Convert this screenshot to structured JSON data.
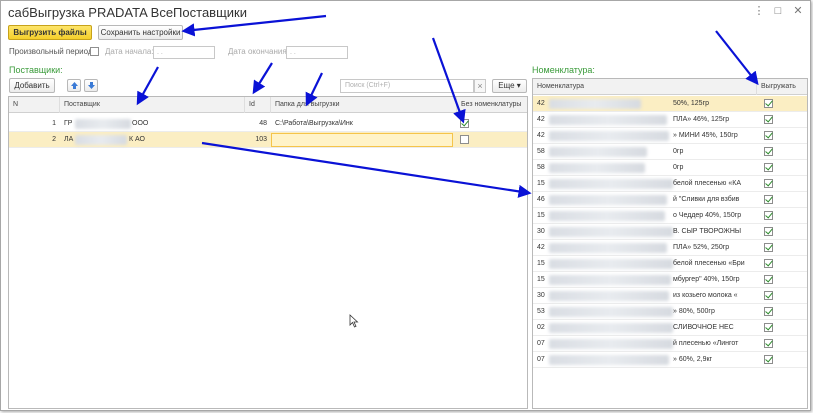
{
  "window": {
    "title": "сабВыгрузка PRADATA ВсеПоставщики",
    "controls": [
      "⋮",
      "□",
      "✕"
    ]
  },
  "toolbar": {
    "export_label": "Выгрузить файлы",
    "save_label": "Сохранить настройки"
  },
  "period": {
    "custom_label": "Произвольный период:",
    "start_label": "Дата начала:",
    "start_placeholder": "  .  .",
    "end_label": "Дата окончания:",
    "end_placeholder": "  .  ."
  },
  "suppliers": {
    "section_label": "Поставщики:",
    "add_label": "Добавить",
    "search_placeholder": "Поиск (Ctrl+F)",
    "search_clear": "×",
    "more_label": "Еще ▾",
    "columns": [
      "N",
      "Поставщик",
      "Id",
      "Папка для выгрузки",
      "Без номенклатуры"
    ],
    "rows": [
      {
        "n": "1",
        "name_prefix": "ГР",
        "name_suffix": "ООО",
        "id": "48",
        "folder": "C:\\Работа\\Выгрузка\\Инк",
        "checked": true
      },
      {
        "n": "2",
        "name_prefix": "ЛА",
        "name_suffix": "К АО",
        "id": "103",
        "folder": "",
        "checked": false
      }
    ]
  },
  "nomenclature": {
    "section_label": "Номенклатура:",
    "columns": [
      "Номенклатура",
      "Выгружать"
    ],
    "rows": [
      {
        "prefix": "42",
        "suffix": "50%, 125гр",
        "checked": true
      },
      {
        "prefix": "42",
        "suffix": "ПЛА» 46%, 125гр",
        "checked": true
      },
      {
        "prefix": "42",
        "suffix": "» МИНИ 45%, 150гр",
        "checked": true
      },
      {
        "prefix": "58",
        "suffix": "0гр",
        "checked": true
      },
      {
        "prefix": "58",
        "suffix": "0гр",
        "checked": true
      },
      {
        "prefix": "15",
        "suffix": "белой плесенью «КА",
        "checked": true
      },
      {
        "prefix": "46",
        "suffix": "й \"Сливки для взбив",
        "checked": true
      },
      {
        "prefix": "15",
        "suffix": "о Чеддер 40%, 150гр",
        "checked": true
      },
      {
        "prefix": "30",
        "suffix": "В. СЫР ТВОРОЖНЫ",
        "checked": true
      },
      {
        "prefix": "42",
        "suffix": "ПЛА» 52%, 250гр",
        "checked": true
      },
      {
        "prefix": "15",
        "suffix": "белой плесенью «Бри",
        "checked": true
      },
      {
        "prefix": "15",
        "suffix": "мбургер\" 40%, 150гр",
        "checked": true
      },
      {
        "prefix": "30",
        "suffix": "из козьего молока «",
        "checked": true
      },
      {
        "prefix": "53",
        "suffix": "» 80%, 500гр",
        "checked": true
      },
      {
        "prefix": "02",
        "suffix": "СЛИВОЧНОЕ НЕС",
        "checked": true
      },
      {
        "prefix": "07",
        "suffix": "й плесенью «Лингот",
        "checked": true
      },
      {
        "prefix": "07",
        "suffix": "» 60%, 2,9кг",
        "checked": true
      }
    ]
  },
  "colors": {
    "accent_yellow": "#f5cf2b",
    "selected_row": "#fbeec3",
    "annotation_arrow": "#0a12d6",
    "section_green": "#3a9b3a"
  }
}
